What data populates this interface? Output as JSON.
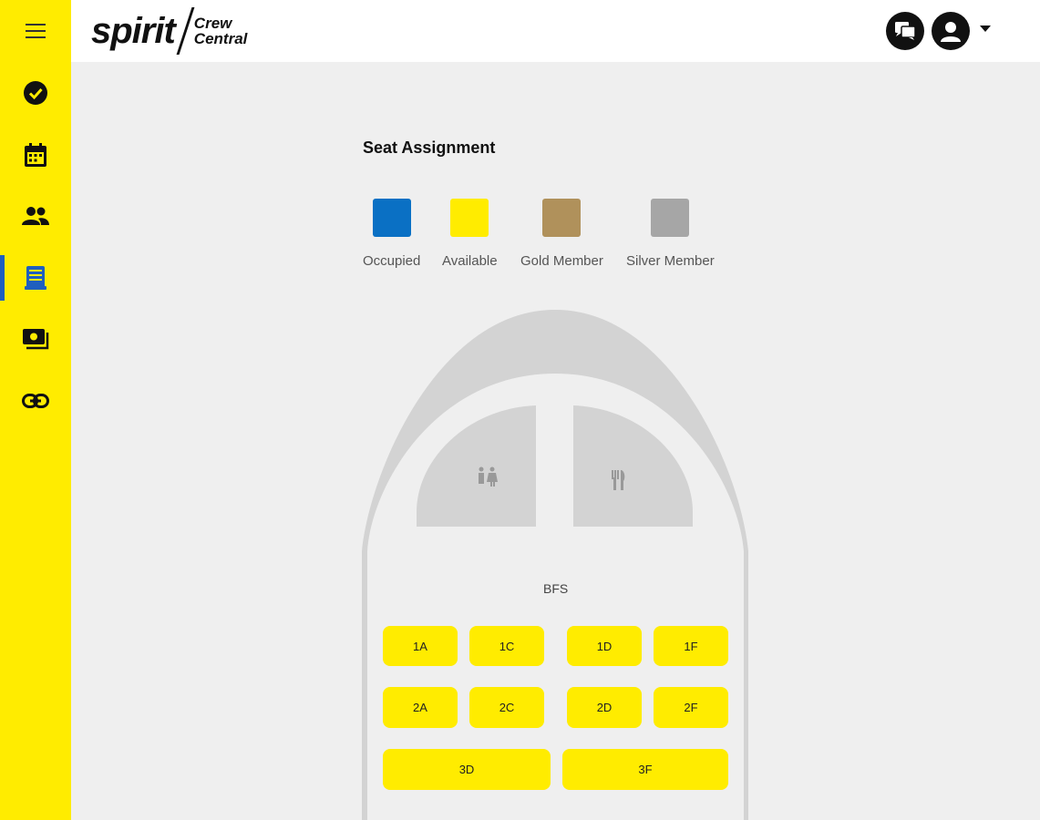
{
  "brand": {
    "name": "spirit",
    "product_line1": "Crew",
    "product_line2": "Central"
  },
  "sidebar": {
    "menu_icon": "hamburger-menu-icon",
    "items": [
      {
        "icon": "check-circle-icon"
      },
      {
        "icon": "calendar-icon"
      },
      {
        "icon": "people-icon"
      },
      {
        "icon": "seat-assignment-icon",
        "active": true
      },
      {
        "icon": "money-icon"
      },
      {
        "icon": "link-icon"
      }
    ]
  },
  "header": {
    "icons": [
      "chat-icon",
      "account-icon",
      "caret-down-icon"
    ]
  },
  "page": {
    "title": "Seat Assignment"
  },
  "legend": [
    {
      "label": "Occupied",
      "color": "#0a70c4"
    },
    {
      "label": "Available",
      "color": "#ffec00"
    },
    {
      "label": "Gold Member",
      "color": "#b0915b"
    },
    {
      "label": "Silver Member",
      "color": "#a6a6a6"
    }
  ],
  "cabin": {
    "section_label": "BFS",
    "amenity_icons": [
      "restroom-icon",
      "galley-icon"
    ],
    "seats": [
      {
        "id": "1A",
        "status": "available"
      },
      {
        "id": "1C",
        "status": "available"
      },
      {
        "id": "1D",
        "status": "available"
      },
      {
        "id": "1F",
        "status": "available"
      },
      {
        "id": "2A",
        "status": "available"
      },
      {
        "id": "2C",
        "status": "available"
      },
      {
        "id": "2D",
        "status": "available"
      },
      {
        "id": "2F",
        "status": "available"
      },
      {
        "id": "3D",
        "status": "available"
      },
      {
        "id": "3F",
        "status": "available"
      }
    ]
  }
}
